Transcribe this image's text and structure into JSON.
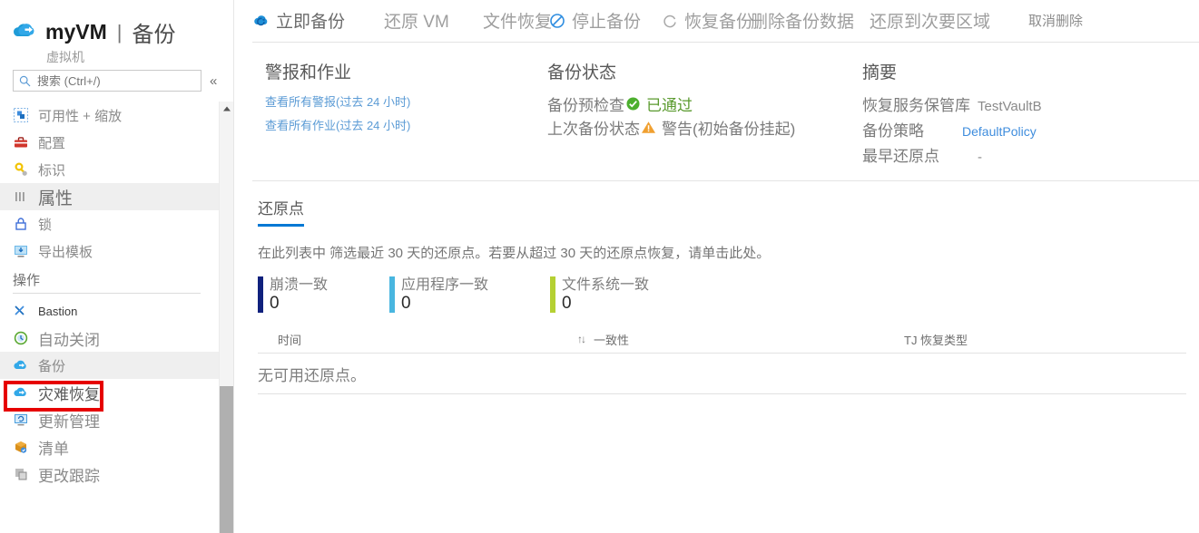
{
  "blade": {
    "icon": "backup-cloud-icon",
    "resource_name": "myVM",
    "separator": "|",
    "page_name": "备份",
    "subtitle": "虚拟机"
  },
  "search": {
    "placeholder": "搜索 (Ctrl+/)",
    "value": "",
    "icon": "search-icon",
    "collapse_label": "«"
  },
  "sidebar": {
    "items": [
      {
        "label": "可用性 + 缩放",
        "icon": "scale-icon",
        "selected": false
      },
      {
        "label": "配置",
        "icon": "toolbox-icon",
        "selected": false
      },
      {
        "label": "标识",
        "icon": "key-icon",
        "selected": false
      },
      {
        "label": "属性",
        "icon": "properties-icon",
        "selected": true
      },
      {
        "label": "锁",
        "icon": "lock-icon",
        "selected": false
      },
      {
        "label": "导出模板",
        "icon": "export-template-icon",
        "selected": false
      }
    ],
    "section_label": "操作",
    "action_items": [
      {
        "label": "Bastion",
        "icon": "bastion-icon",
        "selected": false
      },
      {
        "label": "自动关闭",
        "icon": "auto-shutdown-icon",
        "selected": false
      },
      {
        "label": "备份",
        "icon": "backup-cloud-icon",
        "selected": true
      },
      {
        "label": "灾难恢复",
        "icon": "disaster-recovery-icon",
        "selected": false
      },
      {
        "label": "更新管理",
        "icon": "update-management-icon",
        "selected": false
      },
      {
        "label": "清单",
        "icon": "inventory-icon",
        "selected": false
      },
      {
        "label": "更改跟踪",
        "icon": "change-tracking-icon",
        "selected": false
      }
    ],
    "highlight_target": "备份",
    "highlight_color": "#e60000",
    "scrollbar": {
      "up_arrow": "▲"
    }
  },
  "toolbar": {
    "items": [
      {
        "label": "立即备份",
        "icon": "backup-now-icon",
        "enabled": true
      },
      {
        "label": "还原 VM",
        "icon": "",
        "enabled": false
      },
      {
        "label": "文件恢复",
        "icon": "",
        "enabled": false
      },
      {
        "label": "停止备份",
        "icon": "stop-backup-icon",
        "enabled": false
      },
      {
        "label": "恢复备份",
        "icon": "resume-backup-icon",
        "enabled": false
      },
      {
        "label": "删除备份数据",
        "icon": "delete-backup-icon",
        "enabled": false
      },
      {
        "label": "还原到次要区域",
        "icon": "",
        "enabled": false
      },
      {
        "label": "取消删除",
        "icon": "",
        "enabled": false
      }
    ]
  },
  "alerts": {
    "title": "警报和作业",
    "links": [
      "查看所有警报(过去 24 小时)",
      "查看所有作业(过去 24 小时)"
    ]
  },
  "backup_status": {
    "title": "备份状态",
    "prechecks_label": "备份预检查",
    "prechecks_value": "已通过",
    "prechecks_icon": "success-check-icon",
    "last_backup_label": "上次备份状态",
    "last_backup_value": "警告(初始备份挂起)",
    "last_backup_icon": "warning-triangle-icon"
  },
  "summary": {
    "title": "摘要",
    "rows": [
      {
        "key": "恢复服务保管库",
        "value": "TestVaultB",
        "is_link": false
      },
      {
        "key": "备份策略",
        "value": "DefaultPolicy",
        "is_link": true
      },
      {
        "key": "最早还原点",
        "value": "-",
        "is_link": false
      }
    ]
  },
  "restore_points": {
    "tab_label": "还原点",
    "description": "在此列表中 筛选最近 30 天的还原点。若要从超过 30 天的还原点恢复，请单击此处。",
    "stats": [
      {
        "label": "崩溃一致",
        "value": "0",
        "color": "#10217d"
      },
      {
        "label": "应用程序一致",
        "value": "0",
        "color": "#49b6e0"
      },
      {
        "label": "文件系统一致",
        "value": "0",
        "color": "#b5d033"
      }
    ],
    "table": {
      "columns": [
        "时间",
        "一致性",
        "TJ 恢复类型"
      ],
      "sort_indicator": "↑↓",
      "rows": [],
      "empty_message": "无可用还原点。"
    }
  }
}
